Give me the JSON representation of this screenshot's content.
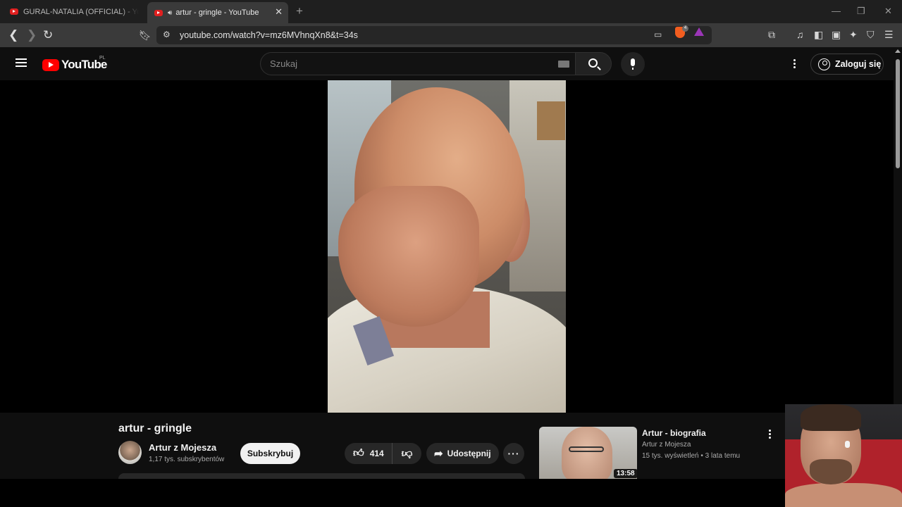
{
  "browser": {
    "tabs": [
      {
        "title": "GURAL-NATALIA (OFFICIAL) - YouTube",
        "active": false
      },
      {
        "title": "artur - gringle - YouTube",
        "active": true,
        "playing_audio": true
      }
    ],
    "new_tab": "+",
    "window_controls": {
      "minimize": "—",
      "restore": "❐",
      "close": "✕"
    },
    "url": "youtube.com/watch?v=mz6MVhnqXn8&t=34s",
    "brave_badge": "4"
  },
  "youtube": {
    "logo_text": "YouTube",
    "country": "PL",
    "search_placeholder": "Szukaj",
    "signin_label": "Zaloguj się"
  },
  "video": {
    "title": "artur - gringle",
    "channel": "Artur z Mojesza",
    "subscribers": "1,17 tys. subskrybentów",
    "subscribe_label": "Subskrybuj",
    "likes": "414",
    "share_label": "Udostępnij",
    "more_label": "···"
  },
  "recommendation": {
    "title": "Artur - biografia",
    "channel": "Artur z Mojesza",
    "views": "15 tys. wyświetleń",
    "age": "3 lata temu",
    "meta": "15 tys. wyświetleń • 3 lata temu",
    "duration": "13:58"
  },
  "colors": {
    "yt_red": "#ff0000",
    "page_bg": "#0f0f0f",
    "chip_bg": "#272727",
    "subscribe_bg": "#f1f1f1"
  }
}
